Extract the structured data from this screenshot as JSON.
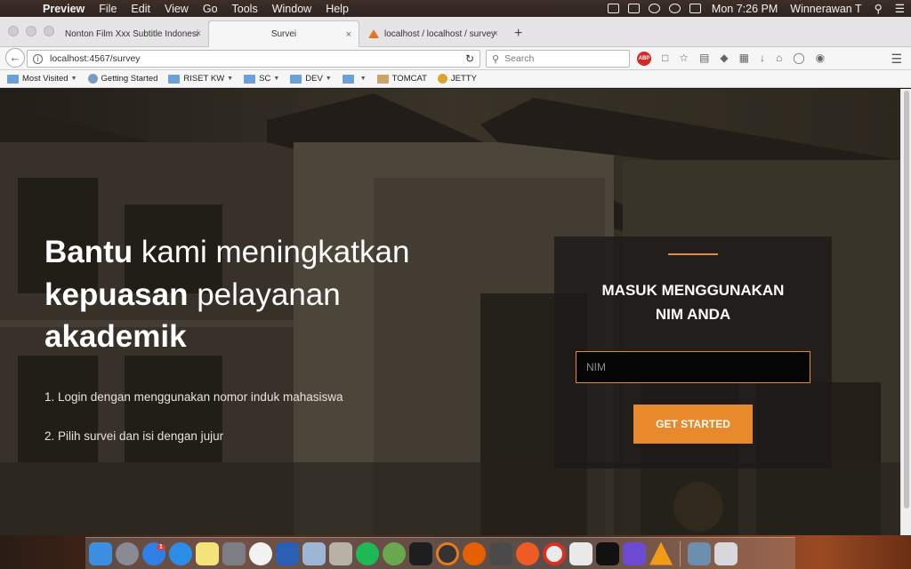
{
  "menubar": {
    "app_name": "Preview",
    "menus": [
      "File",
      "Edit",
      "View",
      "Go",
      "Tools",
      "Window",
      "Help"
    ],
    "clock": "Mon 7:26 PM",
    "user": "Winnerawan T"
  },
  "browser": {
    "tabs": [
      {
        "title": "Nonton Film Xxx Subtitle Indonesi"
      },
      {
        "title": "Survei"
      },
      {
        "title": "localhost / localhost / survey"
      }
    ],
    "url": "localhost:4567/survey",
    "search_placeholder": "Search",
    "abp_label": "ABP",
    "bookmarks": [
      {
        "label": "Most Visited",
        "icon": "folder-icon"
      },
      {
        "label": "Getting Started",
        "icon": "globe-icon"
      },
      {
        "label": "RISET KW",
        "icon": "folder-icon"
      },
      {
        "label": "SC",
        "icon": "folder-icon"
      },
      {
        "label": "DEV",
        "icon": "folder-icon"
      },
      {
        "label": "",
        "icon": "folder-icon"
      },
      {
        "label": "TOMCAT",
        "icon": "tomcat-icon"
      },
      {
        "label": "JETTY",
        "icon": "jetty-icon"
      }
    ]
  },
  "page": {
    "headline_bold_1": "Bantu",
    "headline_rest_1": " kami meningkatkan",
    "headline_bold_2": "kepuasan",
    "headline_rest_2": " pelayanan",
    "headline_bold_3": "akademik",
    "step_1": "1. Login dengan menggunakan nomor induk mahasiswa",
    "step_2": "2. Pilih survei dan isi dengan jujur",
    "login": {
      "title_line_1": "MASUK MENGGUNAKAN",
      "title_line_2": "NIM ANDA",
      "nim_placeholder": "NIM",
      "button_label": "GET STARTED"
    },
    "accent_color": "#e8892b"
  },
  "dock": {
    "apps": [
      "Finder",
      "Launchpad",
      "App Store",
      "Safari",
      "Notes",
      "System Preferences",
      "iTunes",
      "Word",
      "Preview",
      "Archive",
      "Spotify",
      "Android Studio",
      "Terminal",
      "Recorder",
      "Firefox",
      "Sublime Text",
      "Postman",
      "Chrome",
      "Sequel",
      "IntelliJ",
      "Brackets",
      "VLC",
      "Screen",
      "Trash"
    ],
    "app_store_badge": "1"
  }
}
